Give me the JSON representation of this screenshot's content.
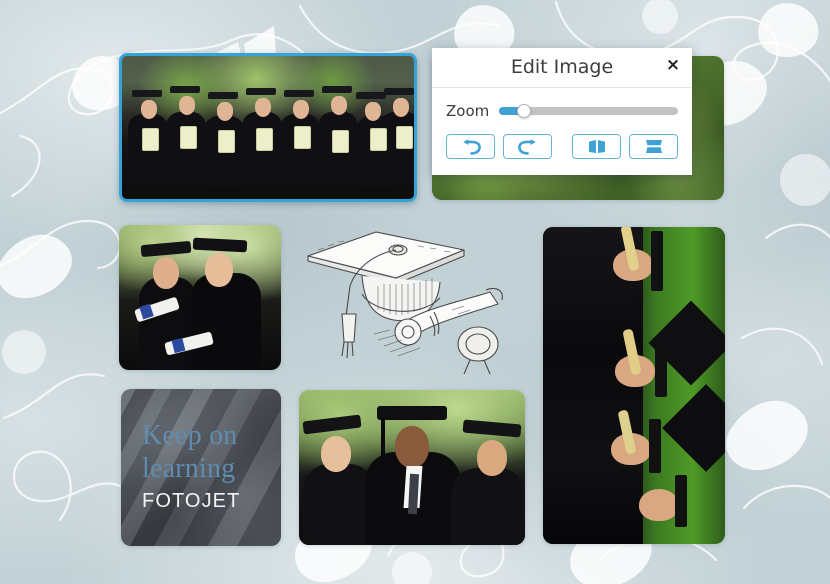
{
  "app": {
    "canvas_background_color": "#c2d1d6",
    "accent_color": "#3fa1d4",
    "selection_color": "#36a3d8"
  },
  "dialog": {
    "title": "Edit Image",
    "close_label": "×",
    "close_icon": "close-icon",
    "zoom": {
      "label": "Zoom",
      "value_percent": 14,
      "min": 0,
      "max": 100
    },
    "buttons": [
      {
        "name": "undo-button",
        "icon": "undo-icon",
        "label": "Undo"
      },
      {
        "name": "redo-button",
        "icon": "redo-icon",
        "label": "Redo"
      },
      {
        "name": "flip-horizontal-button",
        "icon": "flip-horizontal-icon",
        "label": "Flip Horizontal"
      },
      {
        "name": "flip-vertical-button",
        "icon": "flip-vertical-icon",
        "label": "Flip Vertical"
      }
    ]
  },
  "collage": {
    "text_tile": {
      "headline": "Keep on learning",
      "headline_color": "#5e8db1",
      "brand": "FOTOJET",
      "brand_color": "#f2f4f5"
    },
    "photos": [
      {
        "name": "photo-graduation-row",
        "caption": "Row of graduates holding diplomas",
        "selected": true
      },
      {
        "name": "photo-two-graduates",
        "caption": "Two female graduates with diplomas",
        "selected": false
      },
      {
        "name": "photo-graduation-sketch",
        "caption": "Pen sketch of graduation cap and diploma scroll",
        "selected": false
      },
      {
        "name": "photo-graduates-rotated",
        "caption": "Graduates on green background, rotated",
        "selected": false
      },
      {
        "name": "photo-three-graduates",
        "caption": "Three graduates smiling",
        "selected": false
      },
      {
        "name": "photo-green-backdrop",
        "caption": "Green foliage backdrop",
        "selected": false
      }
    ]
  }
}
